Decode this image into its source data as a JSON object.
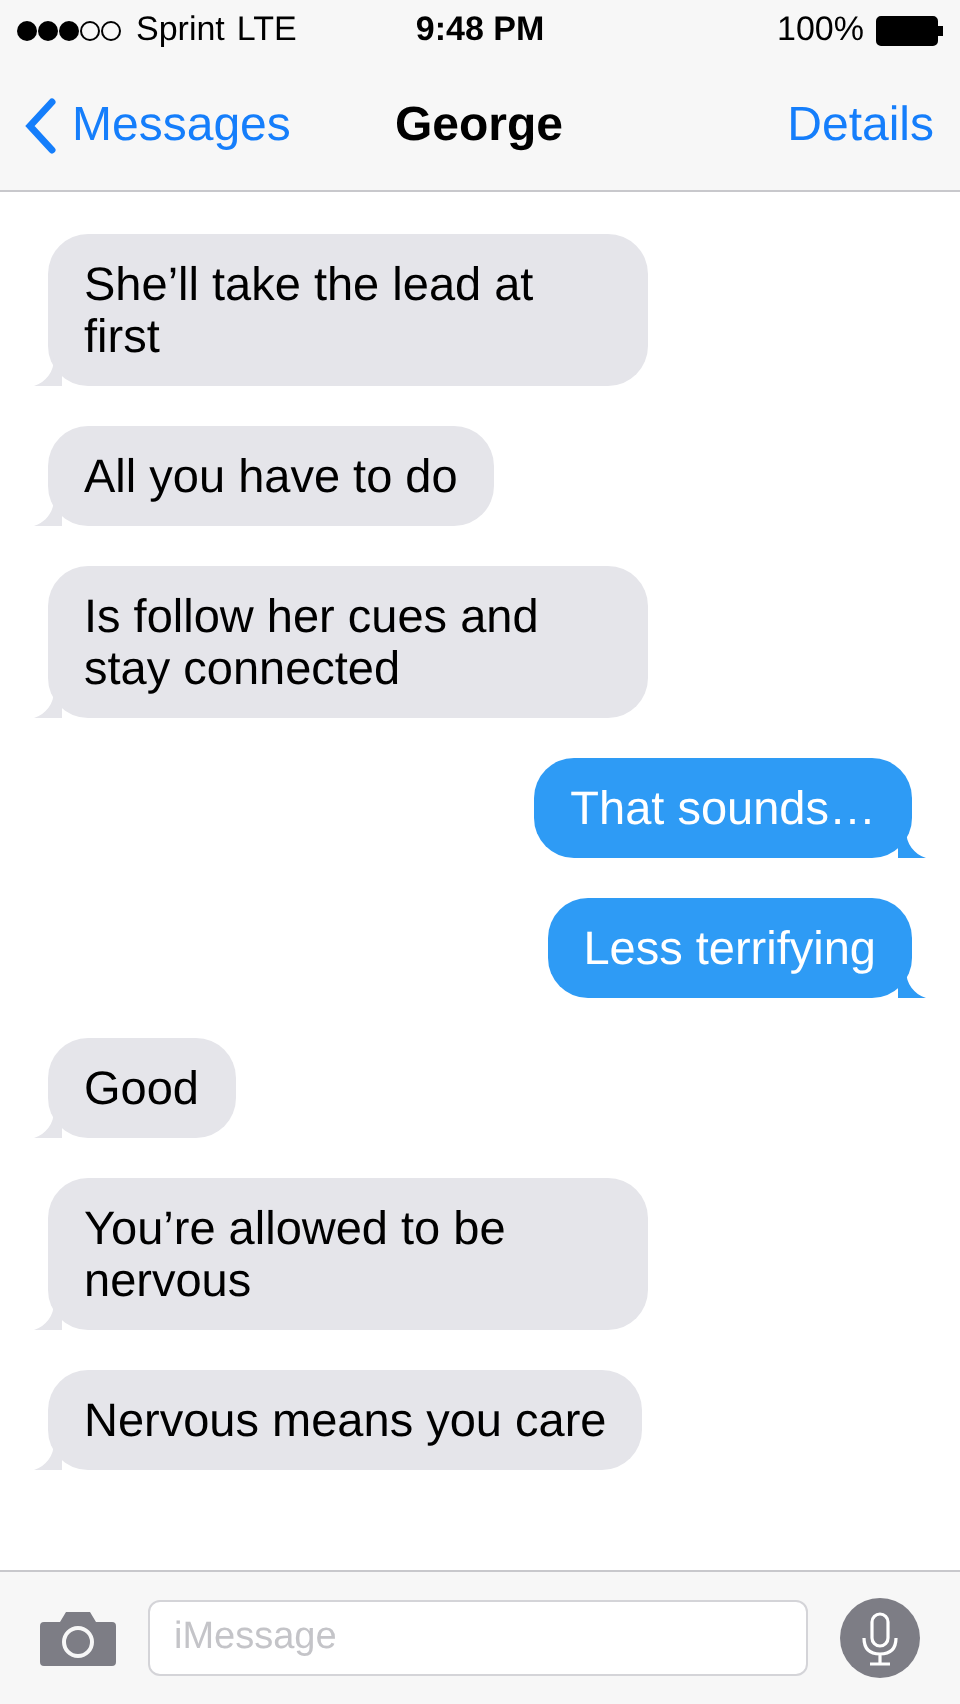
{
  "status_bar": {
    "carrier": "Sprint",
    "network": "LTE",
    "time": "9:48 PM",
    "battery": "100%"
  },
  "nav": {
    "back": "Messages",
    "title": "George",
    "action": "Details"
  },
  "messages": [
    {
      "kind": "received",
      "text": "She’ll take the lead at first"
    },
    {
      "kind": "received",
      "text": "All you have to do"
    },
    {
      "kind": "received",
      "text": "Is follow her cues and stay connected"
    },
    {
      "kind": "sent",
      "text": "That sounds…"
    },
    {
      "kind": "sent",
      "text": "Less terrifying"
    },
    {
      "kind": "received",
      "text": "Good"
    },
    {
      "kind": "received",
      "text": "You’re allowed to be nervous"
    },
    {
      "kind": "received",
      "text": "Nervous means you care"
    }
  ],
  "composer": {
    "placeholder": "iMessage"
  }
}
